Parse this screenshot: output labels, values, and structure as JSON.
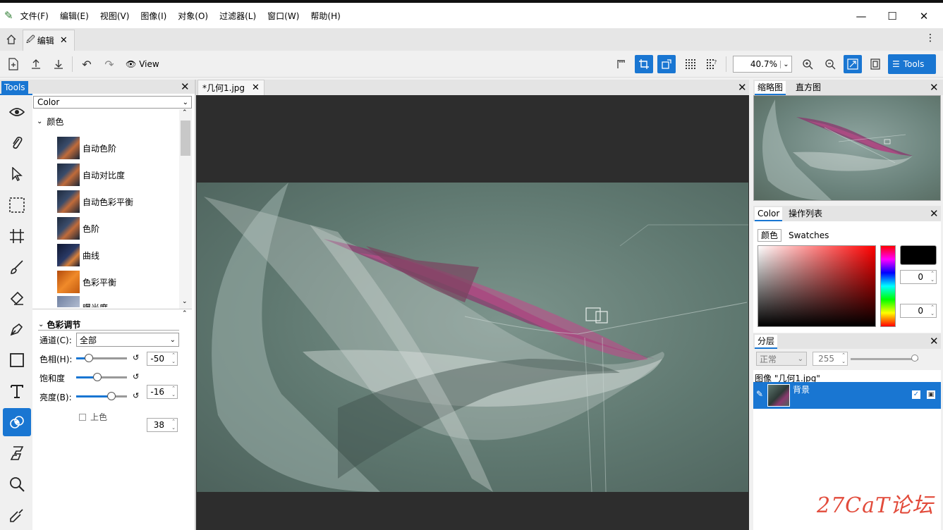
{
  "menu": [
    "文件(F)",
    "编辑(E)",
    "视图(V)",
    "图像(I)",
    "对象(O)",
    "过滤器(L)",
    "窗口(W)",
    "帮助(H)"
  ],
  "tabs": {
    "home_icon": "home-icon",
    "doc_tab": "编辑"
  },
  "toolbar": {
    "view_label": "View",
    "zoom": "40.7%",
    "tools_button": "Tools"
  },
  "tools_panel": {
    "title": "Tools",
    "dropdown": "Color",
    "group": "颜色",
    "items": [
      "自动色阶",
      "自动对比度",
      "自动色彩平衡",
      "色阶",
      "曲线",
      "色彩平衡",
      "曝光度"
    ]
  },
  "color_adjust": {
    "title": "色彩调节",
    "channel_label": "通道(C):",
    "channel_value": "全部",
    "hue_label": "色相(H):",
    "hue_value": "-50",
    "hue_level": 0.25,
    "sat_label": "饱和度",
    "sat_value": "-16",
    "sat_level": 0.42,
    "bri_label": "亮度(B):",
    "bri_value": "38",
    "bri_level": 0.69,
    "colorize_label": "上色"
  },
  "document": {
    "tab_label": "*几何1.jpg"
  },
  "navigator": {
    "tab1": "缩略图",
    "tab2": "直方图"
  },
  "color_panel": {
    "tab1": "Color",
    "tab2": "操作列表",
    "sub1": "颜色",
    "sub2": "Swatches",
    "r": "0",
    "g": "0",
    "b": "0",
    "primary_color": "#000000"
  },
  "layers": {
    "title": "分层",
    "blend_mode": "正常",
    "opacity": "255",
    "image_label": "图像 \"几何1.jpg\"",
    "layer_name": "背景"
  },
  "watermark": "27CaT论坛",
  "colors": {
    "accent": "#1976d2"
  }
}
